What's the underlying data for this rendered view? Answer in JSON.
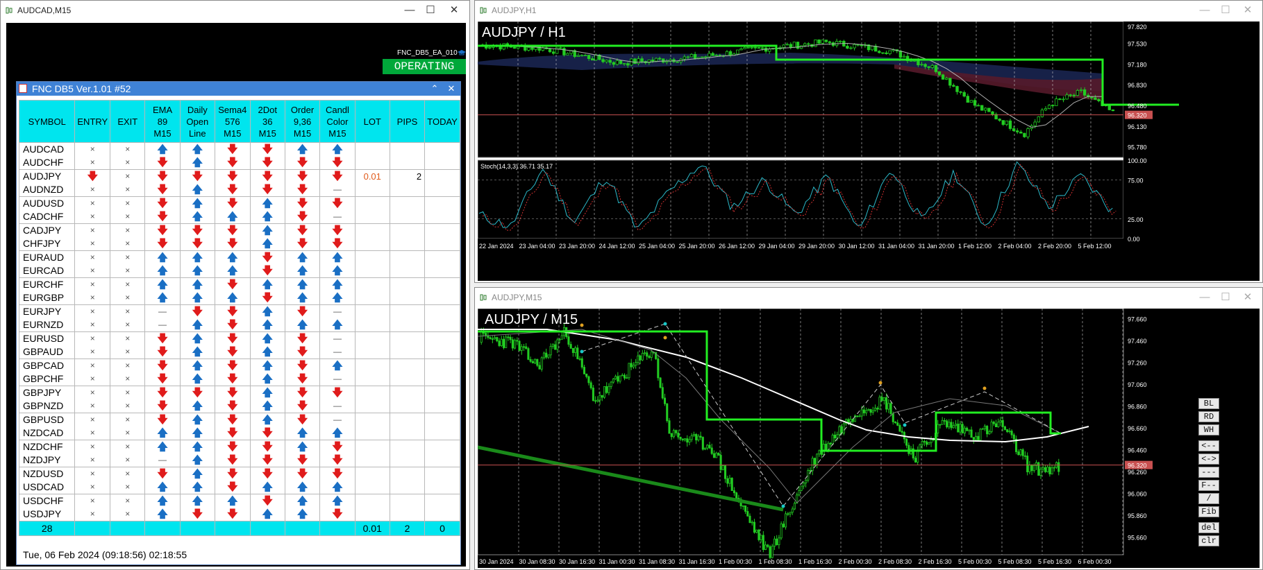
{
  "windows": {
    "left": {
      "title": "AUDCAD,M15"
    },
    "top_right": {
      "title": "AUDJPY,H1"
    },
    "bottom_right": {
      "title": "AUDJPY,M15"
    }
  },
  "ea": {
    "name": "FNC_DB5_EA_010",
    "status": "OPERATING"
  },
  "dashboard": {
    "title": "FNC DB5 Ver.1.01 #52",
    "headers": [
      [
        "SYMBOL"
      ],
      [
        "ENTRY"
      ],
      [
        "EXIT"
      ],
      [
        "EMA",
        "89",
        "M15"
      ],
      [
        "Daily",
        "Open",
        "Line"
      ],
      [
        "Sema4",
        "576",
        "M15"
      ],
      [
        "2Dot",
        "36",
        "M15"
      ],
      [
        "Order",
        "9,36",
        "M15"
      ],
      [
        "Candl",
        "Color",
        "M15"
      ],
      [
        "LOT"
      ],
      [
        "PIPS"
      ],
      [
        "TODAY"
      ]
    ],
    "rows": [
      {
        "symbol": "AUDCAD",
        "entry": "x",
        "exit": "x",
        "ema": "up",
        "daily": "up",
        "sema": "down",
        "dot": "down",
        "order": "up",
        "candle": "up",
        "lot": "",
        "pips": ""
      },
      {
        "symbol": "AUDCHF",
        "entry": "x",
        "exit": "x",
        "ema": "down",
        "daily": "up",
        "sema": "down",
        "dot": "down",
        "order": "down",
        "candle": "down",
        "lot": "",
        "pips": ""
      },
      {
        "symbol": "AUDJPY",
        "entry": "down",
        "exit": "x",
        "ema": "down",
        "daily": "down",
        "sema": "down",
        "dot": "down",
        "order": "down",
        "candle": "down",
        "lot": "0.01",
        "pips": "2"
      },
      {
        "symbol": "AUDNZD",
        "entry": "x",
        "exit": "x",
        "ema": "down",
        "daily": "up",
        "sema": "down",
        "dot": "down",
        "order": "down",
        "candle": "dash",
        "lot": "",
        "pips": ""
      },
      {
        "symbol": "AUDUSD",
        "entry": "x",
        "exit": "x",
        "ema": "down",
        "daily": "up",
        "sema": "down",
        "dot": "up",
        "order": "down",
        "candle": "down",
        "lot": "",
        "pips": ""
      },
      {
        "symbol": "CADCHF",
        "entry": "x",
        "exit": "x",
        "ema": "down",
        "daily": "up",
        "sema": "up",
        "dot": "up",
        "order": "down",
        "candle": "dash",
        "lot": "",
        "pips": ""
      },
      {
        "symbol": "CADJPY",
        "entry": "x",
        "exit": "x",
        "ema": "down",
        "daily": "down",
        "sema": "down",
        "dot": "up",
        "order": "down",
        "candle": "down",
        "lot": "",
        "pips": ""
      },
      {
        "symbol": "CHFJPY",
        "entry": "x",
        "exit": "x",
        "ema": "down",
        "daily": "down",
        "sema": "down",
        "dot": "up",
        "order": "down",
        "candle": "down",
        "lot": "",
        "pips": ""
      },
      {
        "symbol": "EURAUD",
        "entry": "x",
        "exit": "x",
        "ema": "up",
        "daily": "up",
        "sema": "up",
        "dot": "down",
        "order": "up",
        "candle": "up",
        "lot": "",
        "pips": ""
      },
      {
        "symbol": "EURCAD",
        "entry": "x",
        "exit": "x",
        "ema": "up",
        "daily": "up",
        "sema": "up",
        "dot": "down",
        "order": "up",
        "candle": "up",
        "lot": "",
        "pips": ""
      },
      {
        "symbol": "EURCHF",
        "entry": "x",
        "exit": "x",
        "ema": "up",
        "daily": "up",
        "sema": "down",
        "dot": "up",
        "order": "up",
        "candle": "up",
        "lot": "",
        "pips": ""
      },
      {
        "symbol": "EURGBP",
        "entry": "x",
        "exit": "x",
        "ema": "up",
        "daily": "up",
        "sema": "up",
        "dot": "down",
        "order": "up",
        "candle": "up",
        "lot": "",
        "pips": ""
      },
      {
        "symbol": "EURJPY",
        "entry": "x",
        "exit": "x",
        "ema": "dash",
        "daily": "down",
        "sema": "down",
        "dot": "up",
        "order": "down",
        "candle": "dash",
        "lot": "",
        "pips": ""
      },
      {
        "symbol": "EURNZD",
        "entry": "x",
        "exit": "x",
        "ema": "dash",
        "daily": "up",
        "sema": "down",
        "dot": "up",
        "order": "up",
        "candle": "up",
        "lot": "",
        "pips": ""
      },
      {
        "symbol": "EURUSD",
        "entry": "x",
        "exit": "x",
        "ema": "down",
        "daily": "up",
        "sema": "down",
        "dot": "up",
        "order": "down",
        "candle": "dash",
        "lot": "",
        "pips": ""
      },
      {
        "symbol": "GBPAUD",
        "entry": "x",
        "exit": "x",
        "ema": "down",
        "daily": "up",
        "sema": "down",
        "dot": "up",
        "order": "down",
        "candle": "dash",
        "lot": "",
        "pips": ""
      },
      {
        "symbol": "GBPCAD",
        "entry": "x",
        "exit": "x",
        "ema": "down",
        "daily": "up",
        "sema": "down",
        "dot": "up",
        "order": "down",
        "candle": "up",
        "lot": "",
        "pips": ""
      },
      {
        "symbol": "GBPCHF",
        "entry": "x",
        "exit": "x",
        "ema": "down",
        "daily": "up",
        "sema": "down",
        "dot": "up",
        "order": "down",
        "candle": "dash",
        "lot": "",
        "pips": ""
      },
      {
        "symbol": "GBPJPY",
        "entry": "x",
        "exit": "x",
        "ema": "down",
        "daily": "down",
        "sema": "down",
        "dot": "up",
        "order": "down",
        "candle": "down",
        "lot": "",
        "pips": ""
      },
      {
        "symbol": "GBPNZD",
        "entry": "x",
        "exit": "x",
        "ema": "down",
        "daily": "up",
        "sema": "down",
        "dot": "up",
        "order": "down",
        "candle": "dash",
        "lot": "",
        "pips": ""
      },
      {
        "symbol": "GBPUSD",
        "entry": "x",
        "exit": "x",
        "ema": "down",
        "daily": "up",
        "sema": "down",
        "dot": "up",
        "order": "down",
        "candle": "dash",
        "lot": "",
        "pips": ""
      },
      {
        "symbol": "NZDCAD",
        "entry": "x",
        "exit": "x",
        "ema": "up",
        "daily": "up",
        "sema": "down",
        "dot": "down",
        "order": "up",
        "candle": "up",
        "lot": "",
        "pips": ""
      },
      {
        "symbol": "NZDCHF",
        "entry": "x",
        "exit": "x",
        "ema": "up",
        "daily": "up",
        "sema": "down",
        "dot": "down",
        "order": "up",
        "candle": "down",
        "lot": "",
        "pips": ""
      },
      {
        "symbol": "NZDJPY",
        "entry": "x",
        "exit": "x",
        "ema": "dash",
        "daily": "up",
        "sema": "down",
        "dot": "down",
        "order": "down",
        "candle": "down",
        "lot": "",
        "pips": ""
      },
      {
        "symbol": "NZDUSD",
        "entry": "x",
        "exit": "x",
        "ema": "down",
        "daily": "up",
        "sema": "down",
        "dot": "down",
        "order": "down",
        "candle": "down",
        "lot": "",
        "pips": ""
      },
      {
        "symbol": "USDCAD",
        "entry": "x",
        "exit": "x",
        "ema": "up",
        "daily": "up",
        "sema": "down",
        "dot": "up",
        "order": "up",
        "candle": "up",
        "lot": "",
        "pips": ""
      },
      {
        "symbol": "USDCHF",
        "entry": "x",
        "exit": "x",
        "ema": "up",
        "daily": "up",
        "sema": "up",
        "dot": "down",
        "order": "up",
        "candle": "up",
        "lot": "",
        "pips": ""
      },
      {
        "symbol": "USDJPY",
        "entry": "x",
        "exit": "x",
        "ema": "up",
        "daily": "down",
        "sema": "down",
        "dot": "up",
        "order": "up",
        "candle": "down",
        "lot": "",
        "pips": ""
      }
    ],
    "footer": {
      "count": "28",
      "lot": "0.01",
      "pips": "2",
      "today": "0"
    },
    "status_line": "Tue, 06 Feb 2024  (09:18:56)  02:18:55"
  },
  "h1_chart": {
    "label": "AUDJPY / H1",
    "price_ticks": [
      "97.820",
      "97.530",
      "97.180",
      "96.830",
      "96.480",
      "96.130",
      "95.780"
    ],
    "current_price": "96.320",
    "stoch_label": "Stoch(14,3,3) 36.71 35.17",
    "stoch_ticks": [
      "100.00",
      "75.00",
      "25.00",
      "0.00"
    ],
    "time_ticks": [
      "22 Jan 2024",
      "23 Jan 04:00",
      "23 Jan 20:00",
      "24 Jan 12:00",
      "25 Jan 04:00",
      "25 Jan 20:00",
      "26 Jan 12:00",
      "29 Jan 04:00",
      "29 Jan 20:00",
      "30 Jan 12:00",
      "31 Jan 04:00",
      "31 Jan 20:00",
      "1 Feb 12:00",
      "2 Feb 04:00",
      "2 Feb 20:00",
      "5 Feb 12:00"
    ]
  },
  "m15_chart": {
    "label": "AUDJPY / M15",
    "price_ticks": [
      "97.660",
      "97.460",
      "97.260",
      "97.060",
      "96.860",
      "96.660",
      "96.460",
      "96.260",
      "96.060",
      "95.860",
      "95.660"
    ],
    "current_price": "96.320",
    "time_ticks": [
      "30 Jan 2024",
      "30 Jan 08:30",
      "30 Jan 16:30",
      "31 Jan 00:30",
      "31 Jan 08:30",
      "31 Jan 16:30",
      "1 Feb 00:30",
      "1 Feb 08:30",
      "1 Feb 16:30",
      "2 Feb 00:30",
      "2 Feb 08:30",
      "2 Feb 16:30",
      "5 Feb 00:30",
      "5 Feb 08:30",
      "5 Feb 16:30",
      "6 Feb 00:30"
    ]
  },
  "tool_buttons": [
    "BL",
    "RD",
    "WH",
    "<--",
    "<->",
    "---",
    "F--",
    "/",
    "Fib",
    "del",
    "clr"
  ],
  "colors": {
    "up": "#1a6fc4",
    "down": "#e01b1b",
    "header": "#00e5ee",
    "operating": "#00a83a",
    "trend": "#22ee22",
    "bid": "#c85050"
  }
}
